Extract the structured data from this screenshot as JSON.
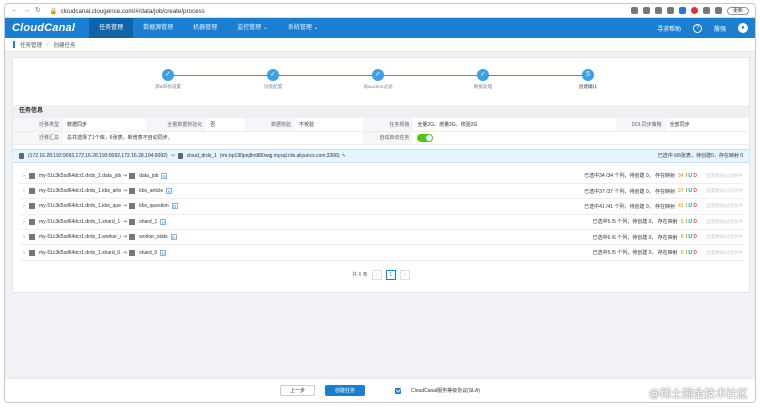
{
  "browser": {
    "url": "cloudcanal.clougence.com/#/data/job/create/process",
    "update_label": "更新"
  },
  "nav": {
    "logo": "CloudCanal",
    "items": [
      {
        "label": "任务管理",
        "active": true
      },
      {
        "label": "数据源管理",
        "active": false
      },
      {
        "label": "机器管理",
        "active": false
      },
      {
        "label": "监控管理 ⌄",
        "active": false
      },
      {
        "label": "系统管理 ⌄",
        "active": false
      }
    ],
    "help_label": "寻求帮助",
    "user_name": "殷强"
  },
  "breadcrumb": {
    "root": "任务管理",
    "current": "创建任务"
  },
  "steps": [
    {
      "label": "源&目标设置"
    },
    {
      "label": "功能配置"
    },
    {
      "label": "表&action过滤"
    },
    {
      "label": "数据处理"
    },
    {
      "label": "创建确认"
    }
  ],
  "info": {
    "title": "任务信息",
    "row1": [
      {
        "k": "迁移类型",
        "v": "数据同步"
      },
      {
        "k": "全量数据校验化",
        "v": "否"
      },
      {
        "k": "数据校验",
        "v": "不校验"
      },
      {
        "k": "任务规格",
        "v": "全量2G、增量2G、校验2G"
      },
      {
        "k": "DDL同步策略",
        "v": "全部同步"
      }
    ],
    "row2_k": "迁移汇总",
    "row2_v": "总共选择了1个库，6张表，新增表不自动同步。",
    "auto_start_k": "自动启动任务"
  },
  "db_row": {
    "source": "(172.16.28.192:9092,172.16.28.193:9092,172.16.28.194:9092)",
    "target": "cloud_drds_1",
    "target_host": "(rm-bp190pnj8m880wqj.mysql.rds.aliyuncs.com:3306)",
    "summary": "已选中 6/6张表，待创建0，存在映射 0"
  },
  "tables": [
    {
      "src": "my-51c3k5sd64dcr1.drds_1.data_job",
      "tgt": "data_job",
      "stat": "已选中34 /34 个列，待创建 0， 存在映射",
      "n": "34",
      "cfg": "配置数据过滤条件"
    },
    {
      "src": "my-51c3k5sd64dcr1.drds_1.kbs_article",
      "tgt": "kbs_article",
      "stat": "已选中37 /37 个列，待创建 0， 存在映射",
      "n": "37",
      "cfg": "配置数据过滤条件"
    },
    {
      "src": "my-51c3k5sd64dcr1.drds_1.kbs_question",
      "tgt": "kbs_question",
      "stat": "已选中41 /41 个列，待创建 0， 存在映射",
      "n": "41",
      "cfg": "配置数据过滤条件"
    },
    {
      "src": "my-51c3k5sd64dcr1.drds_1.shard_1",
      "tgt": "shard_1",
      "stat": "已选中5 /5 个列，待创建 0， 存在映射",
      "n": "5",
      "cfg": "配置数据过滤条件"
    },
    {
      "src": "my-51c3k5sd64dcr1.drds_1.worker_stats",
      "tgt": "worker_stats",
      "stat": "已选中6 /6 个列，待创建 0， 存在映射",
      "n": "6",
      "cfg": "配置数据过滤条件"
    },
    {
      "src": "my-51c3k5sd64dcr1.drds_1.shard_0",
      "tgt": "shard_0",
      "stat": "已选中5 /5 个列，待创建 0， 存在映射",
      "n": "5",
      "cfg": "配置数据过滤条件"
    }
  ],
  "pager": {
    "total": "共 6 条",
    "prev": "‹",
    "page": "1",
    "next": "›"
  },
  "footer": {
    "prev_label": "上一步",
    "create_label": "创建任务",
    "sla_label": "CloudCanal服务等级协议(SLA)"
  },
  "watermark": "@稀土掘金技术社区"
}
